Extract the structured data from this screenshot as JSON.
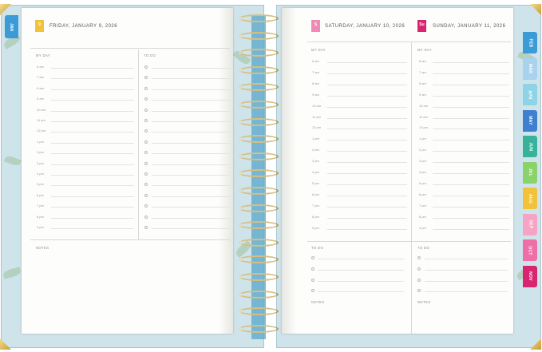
{
  "left_page": {
    "month_tab": "JAN",
    "date_badge": "9",
    "date_title": "FRIDAY, JANUARY 9, 2026",
    "my_day_label": "MY DAY",
    "todo_label": "TO DO",
    "notes_label": "NOTES",
    "times": [
      "6 am",
      "7 am",
      "8 am",
      "9 am",
      "10 am",
      "11 am",
      "12 pm",
      "1 pm",
      "2 pm",
      "3 pm",
      "4 pm",
      "5 pm",
      "6 pm",
      "7 pm",
      "8 pm",
      "9 pm"
    ]
  },
  "right_page": {
    "saturday": {
      "date_badge": "S",
      "date_title": "SATURDAY, JANUARY 10, 2026",
      "my_day_label": "MY DAY",
      "todo_label": "TO DO",
      "notes_label": "NOTES",
      "times": [
        "6 am",
        "7 am",
        "8 am",
        "9 am",
        "10 am",
        "11 am",
        "12 pm",
        "1 pm",
        "2 pm",
        "3 pm",
        "4 pm",
        "5 pm",
        "6 pm",
        "7 pm",
        "8 pm",
        "9 pm"
      ]
    },
    "sunday": {
      "date_badge": "Su",
      "date_title": "SUNDAY, JANUARY 11, 2026",
      "my_day_label": "MY DAY",
      "todo_label": "TO DO",
      "notes_label": "NOTES",
      "times": [
        "6 am",
        "7 am",
        "8 am",
        "9 am",
        "10 am",
        "11 am",
        "12 pm",
        "1 pm",
        "2 pm",
        "3 pm",
        "4 pm",
        "5 pm",
        "6 pm",
        "7 pm",
        "8 pm",
        "9 pm"
      ]
    }
  },
  "month_tabs": [
    {
      "label": "FEB",
      "color": "#3b9bd7"
    },
    {
      "label": "MAR",
      "color": "#a9d2ee"
    },
    {
      "label": "APR",
      "color": "#8fd3e6"
    },
    {
      "label": "MAY",
      "color": "#3f7fd0"
    },
    {
      "label": "JUN",
      "color": "#38b39a"
    },
    {
      "label": "JUL",
      "color": "#8ad36a"
    },
    {
      "label": "AUG",
      "color": "#f2c23a"
    },
    {
      "label": "SEP",
      "color": "#f6a3c6"
    },
    {
      "label": "OCT",
      "color": "#ee6ea6"
    },
    {
      "label": "NOV",
      "color": "#d9246f"
    }
  ],
  "colors": {
    "friday_badge": "#f2c23a",
    "saturday_badge": "#f08ab5",
    "sunday_badge": "#d9246f",
    "jan_tab": "#3b9bd7"
  }
}
